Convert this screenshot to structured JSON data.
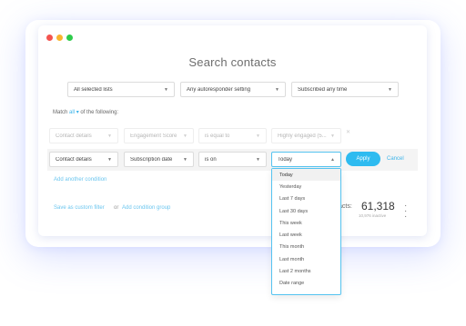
{
  "window": {
    "dots": [
      "#f4544f",
      "#f9b52f",
      "#2ecb4b"
    ]
  },
  "title": "Search contacts",
  "filters": {
    "lists": "All selected lists",
    "autoresponder": "Any autoresponder setting",
    "subscribed": "Subscribed any time"
  },
  "match": {
    "prefix": "Match",
    "value": "all",
    "suffix": "of the following:"
  },
  "condition_faded": {
    "field": "Contact details",
    "criteria": "Engagement Score",
    "operator": "is equal to",
    "value": "Highly engaged (5..."
  },
  "condition_active": {
    "field": "Contact details",
    "criteria": "Subscription date",
    "operator": "is on",
    "value": "Today"
  },
  "buttons": {
    "apply": "Apply",
    "cancel": "Cancel"
  },
  "links": {
    "add_condition": "Add another condition",
    "save_filter": "Save as custom filter",
    "or": "or",
    "add_group": "Add condition group"
  },
  "contacts": {
    "label": "acts:",
    "count": "61,318",
    "sub": "10,976 inactive"
  },
  "dropdown": {
    "selected": "Today",
    "options": [
      "Today",
      "Yesterday",
      "Last 7 days",
      "Last 30 days",
      "This week",
      "Last week",
      "This month",
      "Last month",
      "Last 2 months",
      "Date range"
    ]
  },
  "colors": {
    "accent": "#2ebbf0",
    "link": "#3cb4ea"
  }
}
